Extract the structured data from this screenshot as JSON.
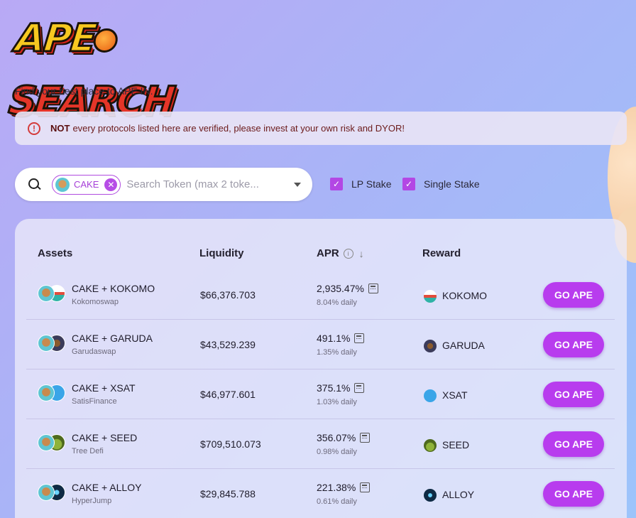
{
  "logo": {
    "part1": "APE",
    "part2": "SEARCH"
  },
  "tagline": "Find your best place to APE IN.",
  "alert": {
    "bold": "NOT",
    "text": "every protocols listed here are verified, please invest at your own risk and DYOR!"
  },
  "search": {
    "chip_label": "CAKE",
    "placeholder": "Search Token (max 2 toke..."
  },
  "filters": {
    "lp_stake": "LP Stake",
    "single_stake": "Single Stake"
  },
  "table": {
    "headers": {
      "assets": "Assets",
      "liquidity": "Liquidity",
      "apr": "APR",
      "reward": "Reward"
    },
    "rows": [
      {
        "pair": "CAKE + KOKOMO",
        "dex": "Kokomoswap",
        "liquidity": "$66,376.703",
        "apr": "2,935.47%",
        "daily": "8.04% daily",
        "reward": "KOKOMO",
        "button": "GO APE"
      },
      {
        "pair": "CAKE + GARUDA",
        "dex": "Garudaswap",
        "liquidity": "$43,529.239",
        "apr": "491.1%",
        "daily": "1.35% daily",
        "reward": "GARUDA",
        "button": "GO APE"
      },
      {
        "pair": "CAKE + XSAT",
        "dex": "SatisFinance",
        "liquidity": "$46,977.601",
        "apr": "375.1%",
        "daily": "1.03% daily",
        "reward": "XSAT",
        "button": "GO APE"
      },
      {
        "pair": "CAKE + SEED",
        "dex": "Tree Defi",
        "liquidity": "$709,510.073",
        "apr": "356.07%",
        "daily": "0.98% daily",
        "reward": "SEED",
        "button": "GO APE"
      },
      {
        "pair": "CAKE + ALLOY",
        "dex": "HyperJump",
        "liquidity": "$29,845.788",
        "apr": "221.38%",
        "daily": "0.61% daily",
        "reward": "ALLOY",
        "button": "GO APE"
      }
    ]
  },
  "colors": {
    "accent": "#b83cee",
    "alert_text": "#6b1a1a"
  }
}
